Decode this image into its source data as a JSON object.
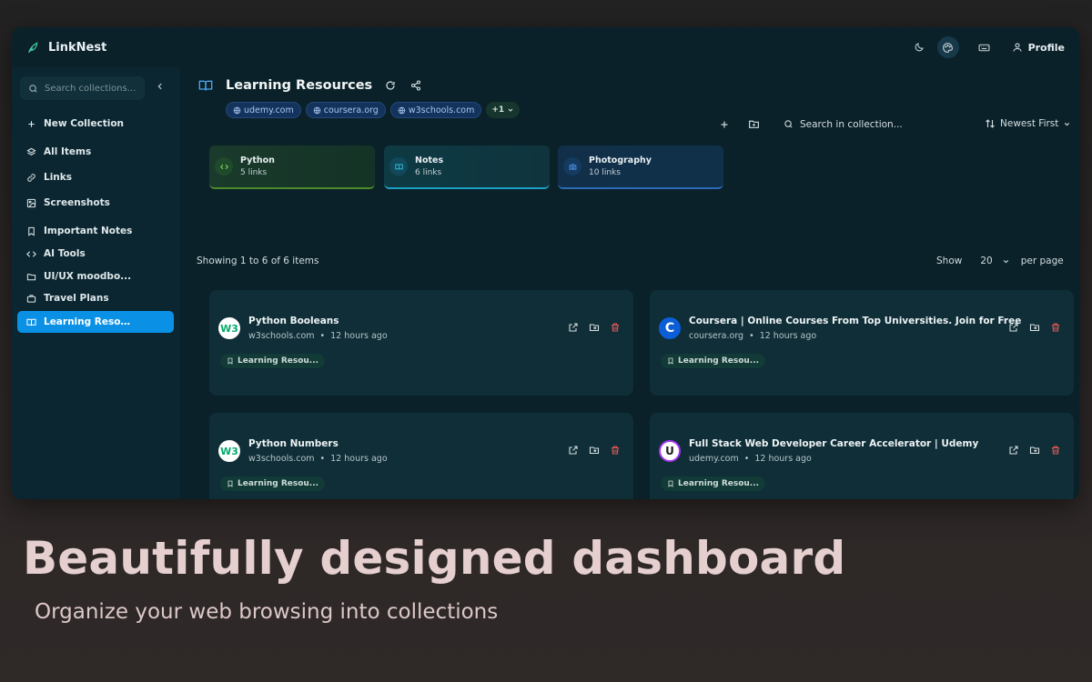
{
  "app": {
    "name": "LinkNest"
  },
  "topbar": {
    "profile_label": "Profile"
  },
  "sidebar": {
    "search_placeholder": "Search collections...",
    "new_collection": "New Collection",
    "items": [
      {
        "label": "All Items",
        "icon": "layers-icon"
      },
      {
        "label": "Links",
        "icon": "link-icon"
      },
      {
        "label": "Screenshots",
        "icon": "image-icon"
      },
      {
        "label": "Important Notes",
        "icon": "bookmark-icon"
      },
      {
        "label": "AI Tools",
        "icon": "code-icon"
      },
      {
        "label": "UI/UX moodbo...",
        "icon": "folder-icon"
      },
      {
        "label": "Travel Plans",
        "icon": "briefcase-icon"
      },
      {
        "label": "Learning Resou...",
        "icon": "book-icon",
        "active": true
      }
    ]
  },
  "collection": {
    "title": "Learning Resources",
    "domains": [
      "udemy.com",
      "coursera.org",
      "w3schools.com"
    ],
    "more_label": "+1",
    "search_placeholder": "Search in collection...",
    "sort_label": "Newest First"
  },
  "subcollections": [
    {
      "name": "Python",
      "count": "5 links",
      "color": "#7fcf5a"
    },
    {
      "name": "Notes",
      "count": "6 links",
      "color": "#2fb6d8"
    },
    {
      "name": "Photography",
      "count": "10 links",
      "color": "#4b8fe6"
    }
  ],
  "listing": {
    "showing_text": "Showing 1 to 6 of 6 items",
    "show_label": "Show",
    "per_page_value": "20",
    "per_page_label": "per page"
  },
  "cards": [
    {
      "title": "Python Booleans",
      "domain": "w3schools.com",
      "time": "12 hours ago",
      "tag": "Learning Resou...",
      "favicon": "W3"
    },
    {
      "title": "Coursera | Online Courses From Top Universities. Join for Free",
      "domain": "coursera.org",
      "time": "12 hours ago",
      "tag": "Learning Resou...",
      "favicon": "C"
    },
    {
      "title": "Python Numbers",
      "domain": "w3schools.com",
      "time": "12 hours ago",
      "tag": "Learning Resou...",
      "favicon": "W3"
    },
    {
      "title": "Full Stack Web Developer Career Accelerator | Udemy",
      "domain": "udemy.com",
      "time": "12 hours ago",
      "tag": "Learning Resou...",
      "favicon": "U"
    }
  ],
  "hero": {
    "title": "Beautifully designed dashboard",
    "subtitle": "Organize your web browsing into collections"
  },
  "colors": {
    "accent": "#0a91e6",
    "background": "#0a2129",
    "delete": "#e05a5a"
  }
}
